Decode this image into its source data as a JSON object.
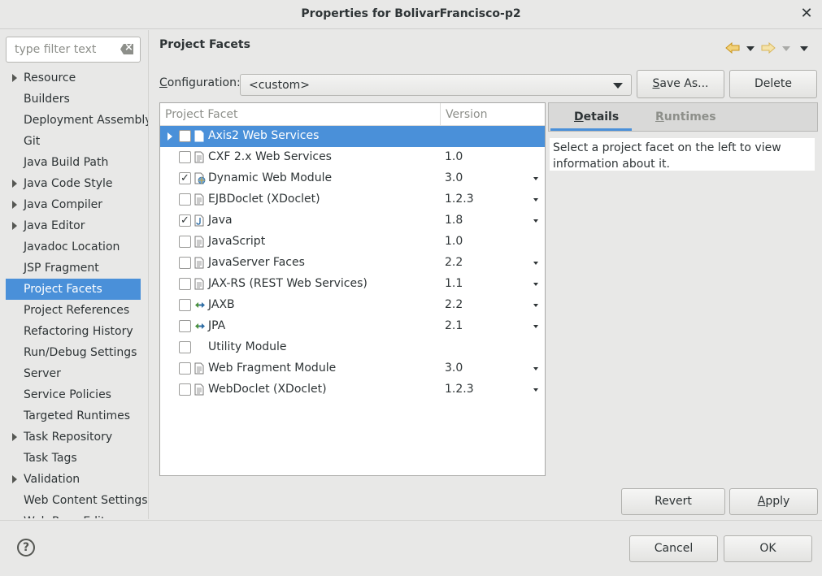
{
  "window": {
    "title": "Properties for BolivarFrancisco-p2",
    "close_icon": "close-icon"
  },
  "sidebar": {
    "filter_placeholder": "type filter text",
    "items": [
      {
        "label": "Resource",
        "expandable": true
      },
      {
        "label": "Builders",
        "expandable": false
      },
      {
        "label": "Deployment Assembly",
        "expandable": false
      },
      {
        "label": "Git",
        "expandable": false
      },
      {
        "label": "Java Build Path",
        "expandable": false
      },
      {
        "label": "Java Code Style",
        "expandable": true
      },
      {
        "label": "Java Compiler",
        "expandable": true
      },
      {
        "label": "Java Editor",
        "expandable": true
      },
      {
        "label": "Javadoc Location",
        "expandable": false
      },
      {
        "label": "JSP Fragment",
        "expandable": false
      },
      {
        "label": "Project Facets",
        "expandable": false,
        "selected": true
      },
      {
        "label": "Project References",
        "expandable": false
      },
      {
        "label": "Refactoring History",
        "expandable": false
      },
      {
        "label": "Run/Debug Settings",
        "expandable": false
      },
      {
        "label": "Server",
        "expandable": false
      },
      {
        "label": "Service Policies",
        "expandable": false
      },
      {
        "label": "Targeted Runtimes",
        "expandable": false
      },
      {
        "label": "Task Repository",
        "expandable": true
      },
      {
        "label": "Task Tags",
        "expandable": false
      },
      {
        "label": "Validation",
        "expandable": true
      },
      {
        "label": "Web Content Settings",
        "expandable": false
      },
      {
        "label": "Web Page Editor",
        "expandable": false
      }
    ]
  },
  "page": {
    "title": "Project Facets",
    "config_label_prefix": "C",
    "config_label_rest": "onfiguration:",
    "config_value": "<custom>",
    "save_as_prefix": "S",
    "save_as_rest": "ave As...",
    "delete_label": "Delete",
    "revert_label": "Revert",
    "apply_prefix": "A",
    "apply_rest": "pply"
  },
  "facets": {
    "col_facet": "Project Facet",
    "col_version": "Version",
    "rows": [
      {
        "name": "Axis2 Web Services",
        "version": "",
        "checked": false,
        "selected": true,
        "expandable": true,
        "icon": "document-icon",
        "dropdown": false
      },
      {
        "name": "CXF 2.x Web Services",
        "version": "1.0",
        "checked": false,
        "icon": "document-icon",
        "dropdown": false
      },
      {
        "name": "Dynamic Web Module",
        "version": "3.0",
        "checked": true,
        "icon": "web-module-icon",
        "dropdown": true
      },
      {
        "name": "EJBDoclet (XDoclet)",
        "version": "1.2.3",
        "checked": false,
        "icon": "document-icon",
        "dropdown": true
      },
      {
        "name": "Java",
        "version": "1.8",
        "checked": true,
        "icon": "java-icon",
        "dropdown": true
      },
      {
        "name": "JavaScript",
        "version": "1.0",
        "checked": false,
        "icon": "document-icon",
        "dropdown": false
      },
      {
        "name": "JavaServer Faces",
        "version": "2.2",
        "checked": false,
        "icon": "document-icon",
        "dropdown": true
      },
      {
        "name": "JAX-RS (REST Web Services)",
        "version": "1.1",
        "checked": false,
        "icon": "document-icon",
        "dropdown": true
      },
      {
        "name": "JAXB",
        "version": "2.2",
        "checked": false,
        "icon": "arrows-icon",
        "dropdown": true
      },
      {
        "name": "JPA",
        "version": "2.1",
        "checked": false,
        "icon": "arrows-icon",
        "dropdown": true
      },
      {
        "name": "Utility Module",
        "version": "",
        "checked": false,
        "icon": "none",
        "dropdown": false
      },
      {
        "name": "Web Fragment Module",
        "version": "3.0",
        "checked": false,
        "icon": "document-icon",
        "dropdown": true
      },
      {
        "name": "WebDoclet (XDoclet)",
        "version": "1.2.3",
        "checked": false,
        "icon": "document-icon",
        "dropdown": true
      }
    ]
  },
  "details": {
    "tab_details_prefix": "D",
    "tab_details_rest": "etails",
    "tab_runtimes_prefix": "R",
    "tab_runtimes_rest": "untimes",
    "text": "Select a project facet on the left to view information about it."
  },
  "footer": {
    "cancel_label": "Cancel",
    "ok_label": "OK",
    "help_symbol": "?"
  },
  "colors": {
    "selection": "#4a90d9",
    "back_arrow": "#e6a817",
    "forward_arrow": "#e6a817"
  }
}
